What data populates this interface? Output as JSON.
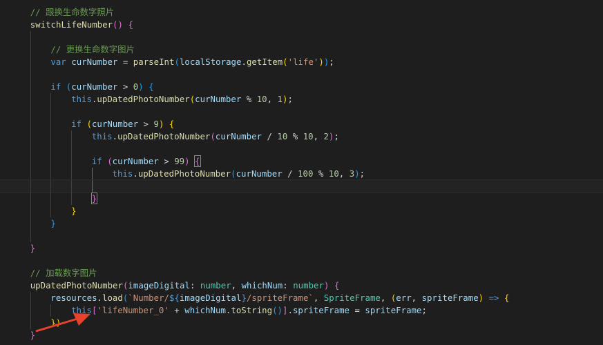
{
  "theme": {
    "background": "#1e1e1e",
    "comment": "#6a9955",
    "keyword": "#569cd6",
    "function": "#dcdcaa",
    "variable": "#9cdcfe",
    "number": "#b5cea8",
    "string": "#ce9178",
    "type": "#4ec9b0",
    "bracket1": "#ffd700",
    "bracket2": "#da70d6",
    "bracket3": "#179fff",
    "annotation_arrow": "#e8412c"
  },
  "lines": [
    {
      "indent": 1,
      "guides": [],
      "tokens": [
        [
          "// 跟换生命数字照片",
          "comment"
        ]
      ]
    },
    {
      "indent": 1,
      "guides": [],
      "tokens": [
        [
          "switchLifeNumber",
          "fn"
        ],
        [
          "()",
          "b2"
        ],
        [
          " ",
          "p"
        ],
        [
          "{",
          "b2"
        ]
      ]
    },
    {
      "indent": 0,
      "guides": [
        1
      ],
      "tokens": []
    },
    {
      "indent": 2,
      "guides": [
        1
      ],
      "tokens": [
        [
          "// 更换生命数字图片",
          "comment"
        ]
      ]
    },
    {
      "indent": 2,
      "guides": [
        1
      ],
      "tokens": [
        [
          "var",
          "kw"
        ],
        [
          " ",
          "p"
        ],
        [
          "curNumber",
          "var"
        ],
        [
          " = ",
          "p"
        ],
        [
          "parseInt",
          "fn"
        ],
        [
          "(",
          "b3"
        ],
        [
          "localStorage",
          "var"
        ],
        [
          ".",
          "p"
        ],
        [
          "getItem",
          "fn"
        ],
        [
          "(",
          "b1"
        ],
        [
          "'life'",
          "str"
        ],
        [
          ")",
          "b1"
        ],
        [
          ")",
          "b3"
        ],
        [
          ";",
          "p"
        ]
      ]
    },
    {
      "indent": 0,
      "guides": [
        1
      ],
      "tokens": []
    },
    {
      "indent": 2,
      "guides": [
        1
      ],
      "tokens": [
        [
          "if",
          "kw"
        ],
        [
          " ",
          "p"
        ],
        [
          "(",
          "b3"
        ],
        [
          "curNumber",
          "var"
        ],
        [
          " > ",
          "p"
        ],
        [
          "0",
          "num"
        ],
        [
          ")",
          "b3"
        ],
        [
          " ",
          "p"
        ],
        [
          "{",
          "b3"
        ]
      ]
    },
    {
      "indent": 3,
      "guides": [
        1,
        2
      ],
      "tokens": [
        [
          "this",
          "kw"
        ],
        [
          ".",
          "p"
        ],
        [
          "upDatedPhotoNumber",
          "fn"
        ],
        [
          "(",
          "b1"
        ],
        [
          "curNumber",
          "var"
        ],
        [
          " % ",
          "p"
        ],
        [
          "10",
          "num"
        ],
        [
          ", ",
          "p"
        ],
        [
          "1",
          "num"
        ],
        [
          ")",
          "b1"
        ],
        [
          ";",
          "p"
        ]
      ]
    },
    {
      "indent": 0,
      "guides": [
        1,
        2
      ],
      "tokens": []
    },
    {
      "indent": 3,
      "guides": [
        1,
        2
      ],
      "tokens": [
        [
          "if",
          "kw"
        ],
        [
          " ",
          "p"
        ],
        [
          "(",
          "b1"
        ],
        [
          "curNumber",
          "var"
        ],
        [
          " > ",
          "p"
        ],
        [
          "9",
          "num"
        ],
        [
          ")",
          "b1"
        ],
        [
          " ",
          "p"
        ],
        [
          "{",
          "b1"
        ]
      ]
    },
    {
      "indent": 4,
      "guides": [
        1,
        2,
        3
      ],
      "tokens": [
        [
          "this",
          "kw"
        ],
        [
          ".",
          "p"
        ],
        [
          "upDatedPhotoNumber",
          "fn"
        ],
        [
          "(",
          "b2"
        ],
        [
          "curNumber",
          "var"
        ],
        [
          " / ",
          "p"
        ],
        [
          "10",
          "num"
        ],
        [
          " % ",
          "p"
        ],
        [
          "10",
          "num"
        ],
        [
          ", ",
          "p"
        ],
        [
          "2",
          "num"
        ],
        [
          ")",
          "b2"
        ],
        [
          ";",
          "p"
        ]
      ]
    },
    {
      "indent": 0,
      "guides": [
        1,
        2,
        3
      ],
      "tokens": []
    },
    {
      "indent": 4,
      "guides": [
        1,
        2,
        3
      ],
      "tokens": [
        [
          "if",
          "kw"
        ],
        [
          " ",
          "p"
        ],
        [
          "(",
          "b2"
        ],
        [
          "curNumber",
          "var"
        ],
        [
          " > ",
          "p"
        ],
        [
          "99",
          "num"
        ],
        [
          ")",
          "b2"
        ],
        [
          " ",
          "p"
        ],
        [
          "{",
          "b2m"
        ]
      ]
    },
    {
      "indent": 5,
      "guides": [
        1,
        2,
        3,
        4
      ],
      "active": 4,
      "tokens": [
        [
          "this",
          "kw"
        ],
        [
          ".",
          "p"
        ],
        [
          "upDatedPhotoNumber",
          "fn"
        ],
        [
          "(",
          "b3"
        ],
        [
          "curNumber",
          "var"
        ],
        [
          " / ",
          "p"
        ],
        [
          "100",
          "num"
        ],
        [
          " % ",
          "p"
        ],
        [
          "10",
          "num"
        ],
        [
          ", ",
          "p"
        ],
        [
          "3",
          "num"
        ],
        [
          ")",
          "b3"
        ],
        [
          ";",
          "p"
        ]
      ]
    },
    {
      "indent": 0,
      "guides": [
        1,
        2,
        3,
        4
      ],
      "active": 4,
      "current": true,
      "tokens": []
    },
    {
      "indent": 4,
      "guides": [
        1,
        2,
        3
      ],
      "tokens": [
        [
          "}",
          "b2m"
        ]
      ]
    },
    {
      "indent": 3,
      "guides": [
        1,
        2
      ],
      "tokens": [
        [
          "}",
          "b1"
        ]
      ]
    },
    {
      "indent": 2,
      "guides": [
        1
      ],
      "tokens": [
        [
          "}",
          "b3"
        ]
      ]
    },
    {
      "indent": 0,
      "guides": [
        1
      ],
      "tokens": []
    },
    {
      "indent": 1,
      "guides": [],
      "tokens": [
        [
          "}",
          "b2"
        ]
      ]
    },
    {
      "indent": 0,
      "guides": [],
      "tokens": []
    },
    {
      "indent": 1,
      "guides": [],
      "tokens": [
        [
          "// 加载数字图片",
          "comment"
        ]
      ]
    },
    {
      "indent": 1,
      "guides": [],
      "tokens": [
        [
          "upDatedPhotoNumber",
          "fn"
        ],
        [
          "(",
          "b2"
        ],
        [
          "imageDigital",
          "var"
        ],
        [
          ": ",
          "p"
        ],
        [
          "number",
          "type"
        ],
        [
          ", ",
          "p"
        ],
        [
          "whichNum",
          "var"
        ],
        [
          ": ",
          "p"
        ],
        [
          "number",
          "type"
        ],
        [
          ")",
          "b2"
        ],
        [
          " ",
          "p"
        ],
        [
          "{",
          "b2"
        ]
      ]
    },
    {
      "indent": 2,
      "guides": [
        1
      ],
      "tokens": [
        [
          "resources",
          "var"
        ],
        [
          ".",
          "p"
        ],
        [
          "load",
          "fn"
        ],
        [
          "(",
          "b3"
        ],
        [
          "`Number/",
          "str"
        ],
        [
          "${",
          "kw"
        ],
        [
          "imageDigital",
          "var"
        ],
        [
          "}",
          "kw"
        ],
        [
          "/spriteFrame`",
          "str"
        ],
        [
          ", ",
          "p"
        ],
        [
          "SpriteFrame",
          "type"
        ],
        [
          ", ",
          "p"
        ],
        [
          "(",
          "b1"
        ],
        [
          "err",
          "var"
        ],
        [
          ", ",
          "p"
        ],
        [
          "spriteFrame",
          "var"
        ],
        [
          ")",
          "b1"
        ],
        [
          " => ",
          "kw"
        ],
        [
          "{",
          "b1"
        ]
      ]
    },
    {
      "indent": 3,
      "guides": [
        1,
        2
      ],
      "tokens": [
        [
          "this",
          "kw"
        ],
        [
          "[",
          "b2"
        ],
        [
          "'lifeNumber_0'",
          "str"
        ],
        [
          " + ",
          "p"
        ],
        [
          "whichNum",
          "var"
        ],
        [
          ".",
          "p"
        ],
        [
          "toString",
          "fn"
        ],
        [
          "()",
          "b3"
        ],
        [
          "]",
          "b2"
        ],
        [
          ".",
          "p"
        ],
        [
          "spriteFrame",
          "var"
        ],
        [
          " = ",
          "p"
        ],
        [
          "spriteFrame",
          "var"
        ],
        [
          ";",
          "p"
        ]
      ]
    },
    {
      "indent": 2,
      "guides": [
        1
      ],
      "tokens": [
        [
          "})",
          "b1"
        ]
      ]
    },
    {
      "indent": 1,
      "guides": [],
      "tokens": [
        [
          "}",
          "b2"
        ]
      ]
    }
  ]
}
